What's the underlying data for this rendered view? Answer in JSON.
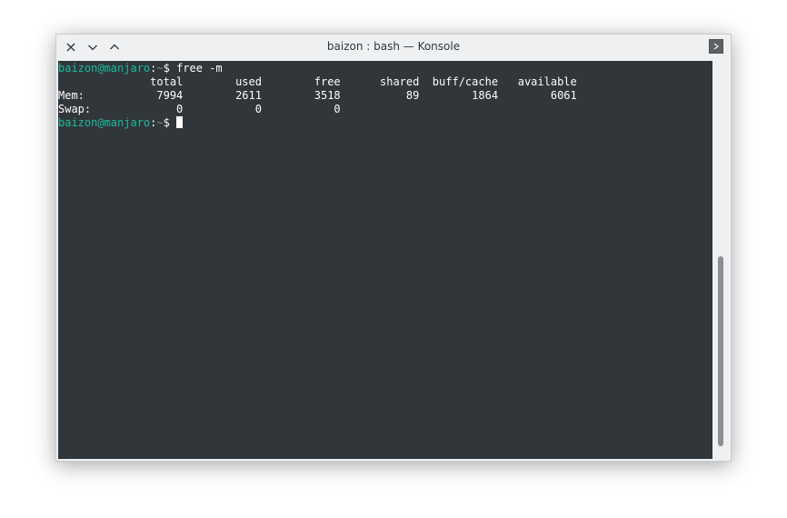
{
  "window": {
    "title": "baizon : bash — Konsole",
    "buttons": [
      "close-icon",
      "minimize-icon",
      "maximize-icon"
    ],
    "menu_icon": "chevron-right-icon"
  },
  "terminal": {
    "colors": {
      "background": "#31363b",
      "foreground": "#fcfcfc",
      "prompt_user": "#1abc9c",
      "prompt_dir": "#7f8c8d"
    },
    "prompt": {
      "user_host": "baizon@manjaro",
      "sep": ":",
      "dir": "~",
      "dollar": "$ "
    },
    "command": "free -m",
    "output": [
      "              total        used        free      shared  buff/cache   available",
      "Mem:           7994        2611        3518          89        1864        6061",
      "Swap:             0           0           0"
    ]
  },
  "scrollbar": {
    "thumb_start": 0.49,
    "thumb_fraction": 0.49
  }
}
